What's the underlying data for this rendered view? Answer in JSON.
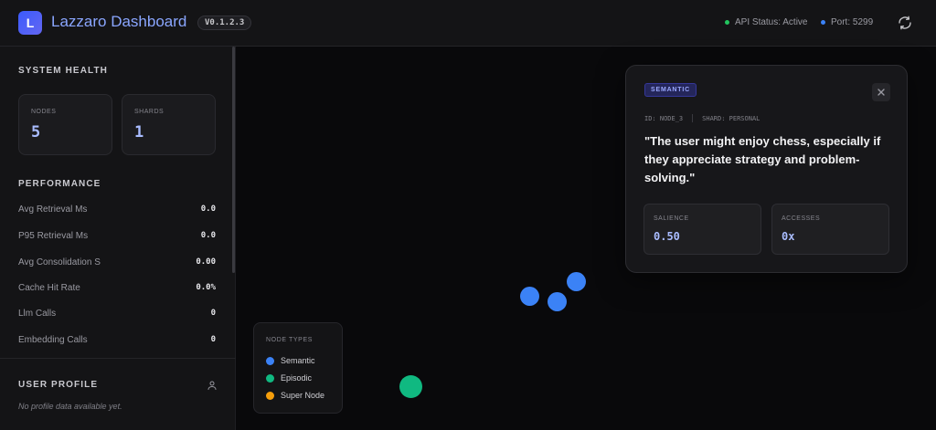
{
  "header": {
    "logo_letter": "L",
    "title": "Lazzaro Dashboard",
    "version": "V0.1.2.3",
    "api_status": "API Status: Active",
    "port": "Port: 5299",
    "api_status_color": "#22c55e",
    "port_color": "#3b82f6",
    "refresh_icon": "refresh-icon"
  },
  "sidebar": {
    "system_health": {
      "title": "SYSTEM HEALTH",
      "cards": [
        {
          "label": "NODES",
          "value": "5"
        },
        {
          "label": "SHARDS",
          "value": "1"
        }
      ]
    },
    "performance": {
      "title": "PERFORMANCE",
      "metrics": [
        {
          "label": "Avg Retrieval Ms",
          "value": "0.0"
        },
        {
          "label": "P95 Retrieval Ms",
          "value": "0.0"
        },
        {
          "label": "Avg Consolidation S",
          "value": "0.00"
        },
        {
          "label": "Cache Hit Rate",
          "value": "0.0%"
        },
        {
          "label": "Llm Calls",
          "value": "0"
        },
        {
          "label": "Embedding Calls",
          "value": "0"
        }
      ]
    },
    "user_profile": {
      "title": "USER PROFILE",
      "empty_text": "No profile data available yet.",
      "icon": "user-icon"
    }
  },
  "legend": {
    "title": "NODE TYPES",
    "items": [
      {
        "label": "Semantic",
        "color": "#3b82f6"
      },
      {
        "label": "Episodic",
        "color": "#10b981"
      },
      {
        "label": "Super Node",
        "color": "#f59e0b"
      }
    ]
  },
  "graph": {
    "node_types": [
      "semantic",
      "semantic",
      "semantic",
      "episodic"
    ],
    "colors": {
      "semantic": "#3b82f6",
      "episodic": "#10b981"
    }
  },
  "detail": {
    "type": "SEMANTIC",
    "id": "ID: NODE_3",
    "shard": "SHARD: PERSONAL",
    "content": "\"The user might enjoy chess, especially if they appreciate strategy and problem-solving.\"",
    "salience_label": "SALIENCE",
    "salience_value": "0.50",
    "accesses_label": "ACCESSES",
    "accesses_value": "0x"
  }
}
